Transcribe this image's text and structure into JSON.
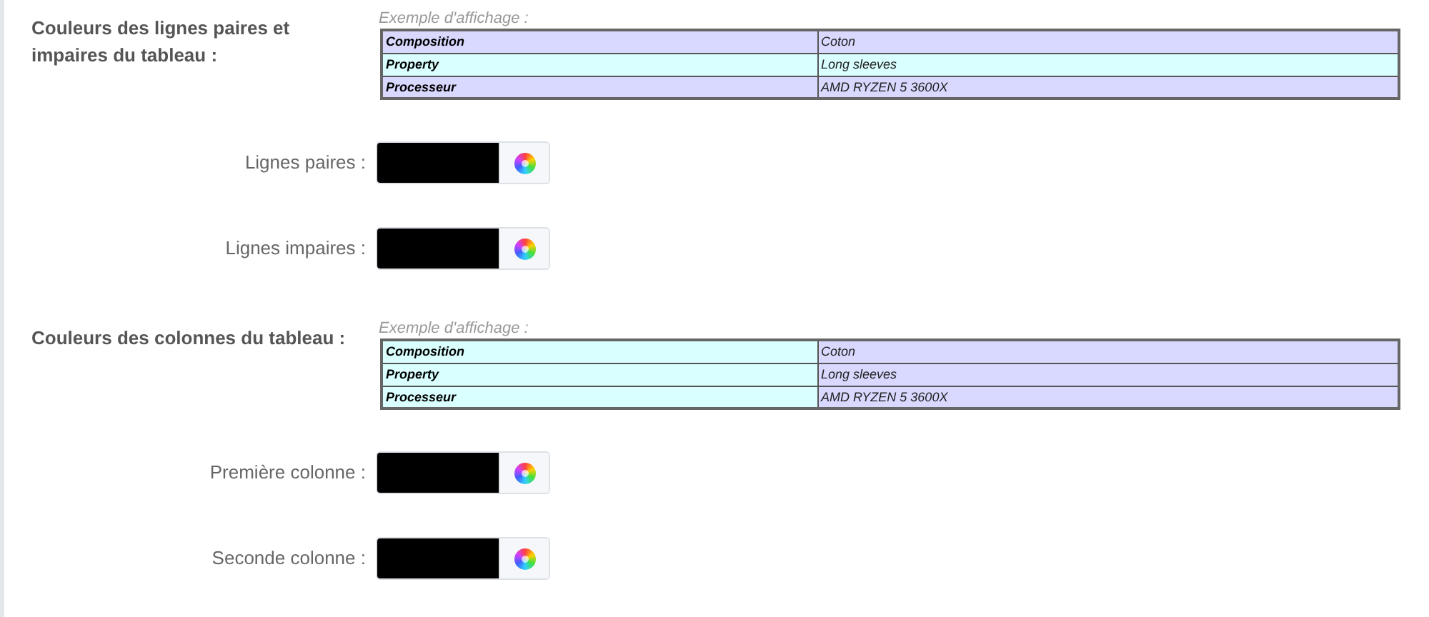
{
  "sections": [
    {
      "title": "Couleurs des lignes paires et impaires du tableau :",
      "example_label": "Exemple d'affichage :",
      "table": {
        "rows": [
          {
            "color": "#d9d9ff",
            "cells": [
              "Composition",
              "Coton"
            ]
          },
          {
            "color": "#d9ffff",
            "cells": [
              "Property",
              "Long sleeves"
            ]
          },
          {
            "color": "#d9d9ff",
            "cells": [
              "Processeur",
              "AMD RYZEN 5 3600X"
            ]
          }
        ]
      },
      "fields": [
        {
          "label": "Lignes paires :",
          "color": "#000000"
        },
        {
          "label": "Lignes impaires :",
          "color": "#000000"
        }
      ]
    },
    {
      "title": "Couleurs des colonnes du tableau :",
      "example_label": "Exemple d'affichage :",
      "table": {
        "columns": [
          {
            "color": "#d9ffff"
          },
          {
            "color": "#d9d9ff"
          }
        ],
        "rows": [
          {
            "cells": [
              "Composition",
              "Coton"
            ]
          },
          {
            "cells": [
              "Property",
              "Long sleeves"
            ]
          },
          {
            "cells": [
              "Processeur",
              "AMD RYZEN 5 3600X"
            ]
          }
        ]
      },
      "fields": [
        {
          "label": "Première colonne :",
          "color": "#000000"
        },
        {
          "label": "Seconde colonne :",
          "color": "#000000"
        }
      ]
    }
  ]
}
